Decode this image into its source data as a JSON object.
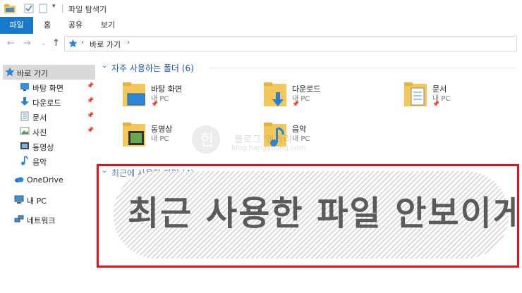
{
  "window": {
    "title": "파일 탐색기"
  },
  "ribbon": {
    "tabs": [
      "파일",
      "홈",
      "공유",
      "보기"
    ]
  },
  "address": {
    "path": "바로 가기"
  },
  "sidebar": {
    "items": [
      {
        "label": "바로 가기",
        "icon": "star-icon",
        "pinned": false
      },
      {
        "label": "바탕 화면",
        "icon": "desktop-icon",
        "pinned": true
      },
      {
        "label": "다운로드",
        "icon": "download-arrow-icon",
        "pinned": true
      },
      {
        "label": "문서",
        "icon": "document-icon",
        "pinned": true
      },
      {
        "label": "사진",
        "icon": "pictures-icon",
        "pinned": true
      },
      {
        "label": "동영상",
        "icon": "video-icon",
        "pinned": false
      },
      {
        "label": "음악",
        "icon": "music-note-icon",
        "pinned": false
      },
      {
        "label": "OneDrive",
        "icon": "cloud-icon",
        "pinned": false
      },
      {
        "label": "내 PC",
        "icon": "computer-icon",
        "pinned": false
      },
      {
        "label": "네트워크",
        "icon": "network-icon",
        "pinned": false
      }
    ]
  },
  "frequent": {
    "title": "자주 사용하는 폴더 (6)",
    "folders": [
      {
        "name": "바탕 화면",
        "sub": "내 PC",
        "icon": "desktop-folder-icon"
      },
      {
        "name": "다운로드",
        "sub": "내 PC",
        "icon": "download-folder-icon"
      },
      {
        "name": "문서",
        "sub": "내 PC",
        "icon": "documents-folder-icon"
      },
      {
        "name": "동영상",
        "sub": "내 PC",
        "icon": "video-folder-icon"
      },
      {
        "name": "음악",
        "sub": "내 PC",
        "icon": "music-folder-icon"
      }
    ]
  },
  "recent": {
    "title": "최근에 사용한 파일 (4)"
  },
  "overlay": {
    "text": "최근 사용한 파일 안보이게"
  },
  "watermark": {
    "text": "블로그 앵커려",
    "url": "blog.hangyeong.com"
  },
  "colors": {
    "accent": "#1979ca",
    "highlight": "#e0141e",
    "folder": "#f2c85a",
    "link": "#1e5799"
  }
}
